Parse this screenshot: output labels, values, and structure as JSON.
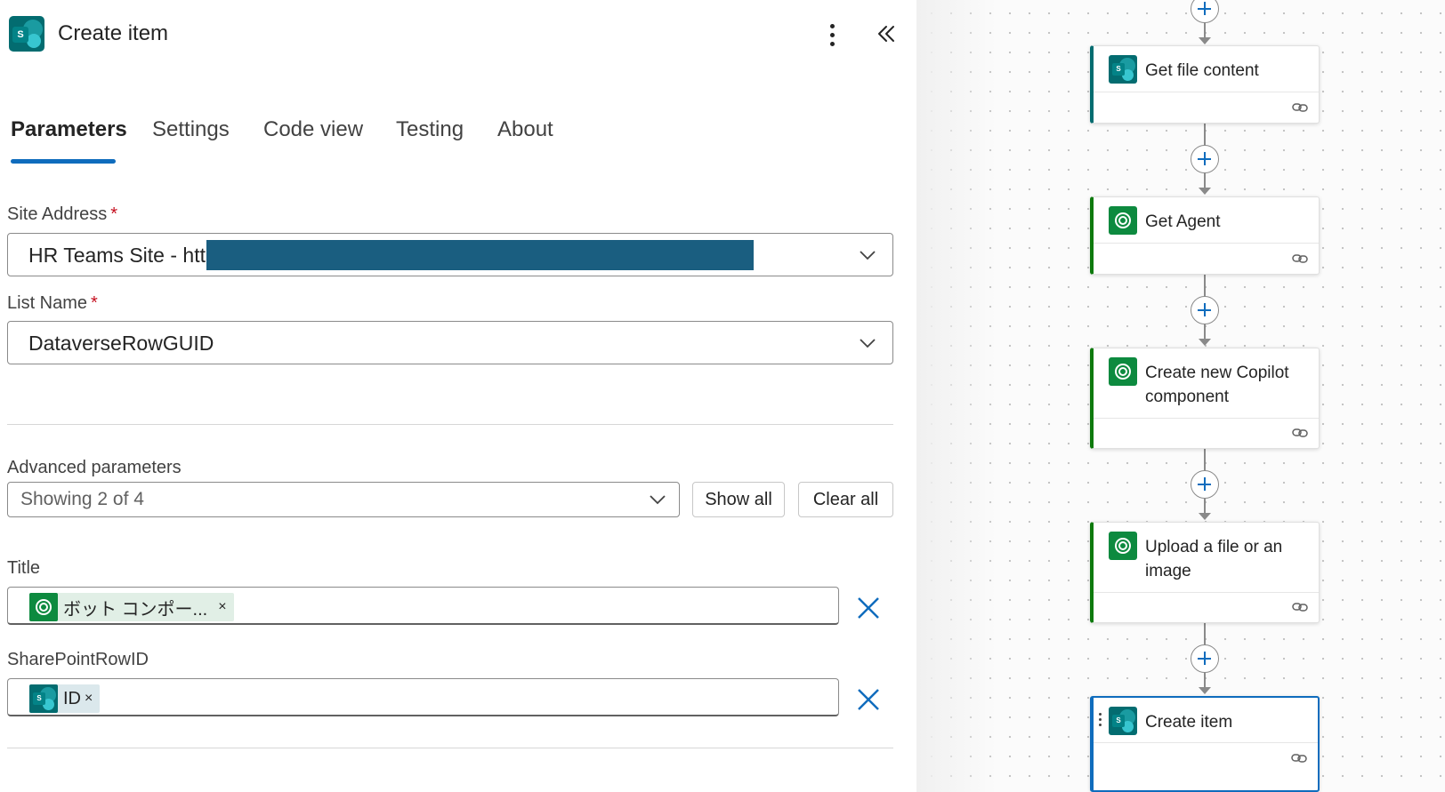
{
  "header": {
    "title": "Create item",
    "icon": "sharepoint-icon"
  },
  "tabs": [
    "Parameters",
    "Settings",
    "Code view",
    "Testing",
    "About"
  ],
  "active_tab": "Parameters",
  "site_address": {
    "label": "Site Address",
    "required": "*",
    "value": "HR Teams Site - http"
  },
  "list_name": {
    "label": "List Name",
    "required": "*",
    "value": "DataverseRowGUID"
  },
  "advanced": {
    "label": "Advanced parameters",
    "value": "Showing 2 of 4",
    "show_all": "Show all",
    "clear_all": "Clear all"
  },
  "title_field": {
    "label": "Title",
    "token": "ボット コンポー...",
    "token_remove": "×"
  },
  "sharepoint_row_field": {
    "label": "SharePointRowID",
    "token": "ID",
    "token_remove": "×"
  },
  "flow": {
    "cards": [
      {
        "title": "Get file content",
        "connector": "sharepoint"
      },
      {
        "title": "Get Agent",
        "connector": "dataverse"
      },
      {
        "title": "Create new Copilot component",
        "connector": "dataverse"
      },
      {
        "title": "Upload a file or an image",
        "connector": "dataverse"
      },
      {
        "title": "Create item",
        "connector": "sharepoint",
        "selected": true
      }
    ]
  },
  "colors": {
    "accent": "#0f6cbd",
    "sharepoint": "#036c70",
    "dataverse": "#0d8a3f",
    "required": "#c50f1f"
  }
}
